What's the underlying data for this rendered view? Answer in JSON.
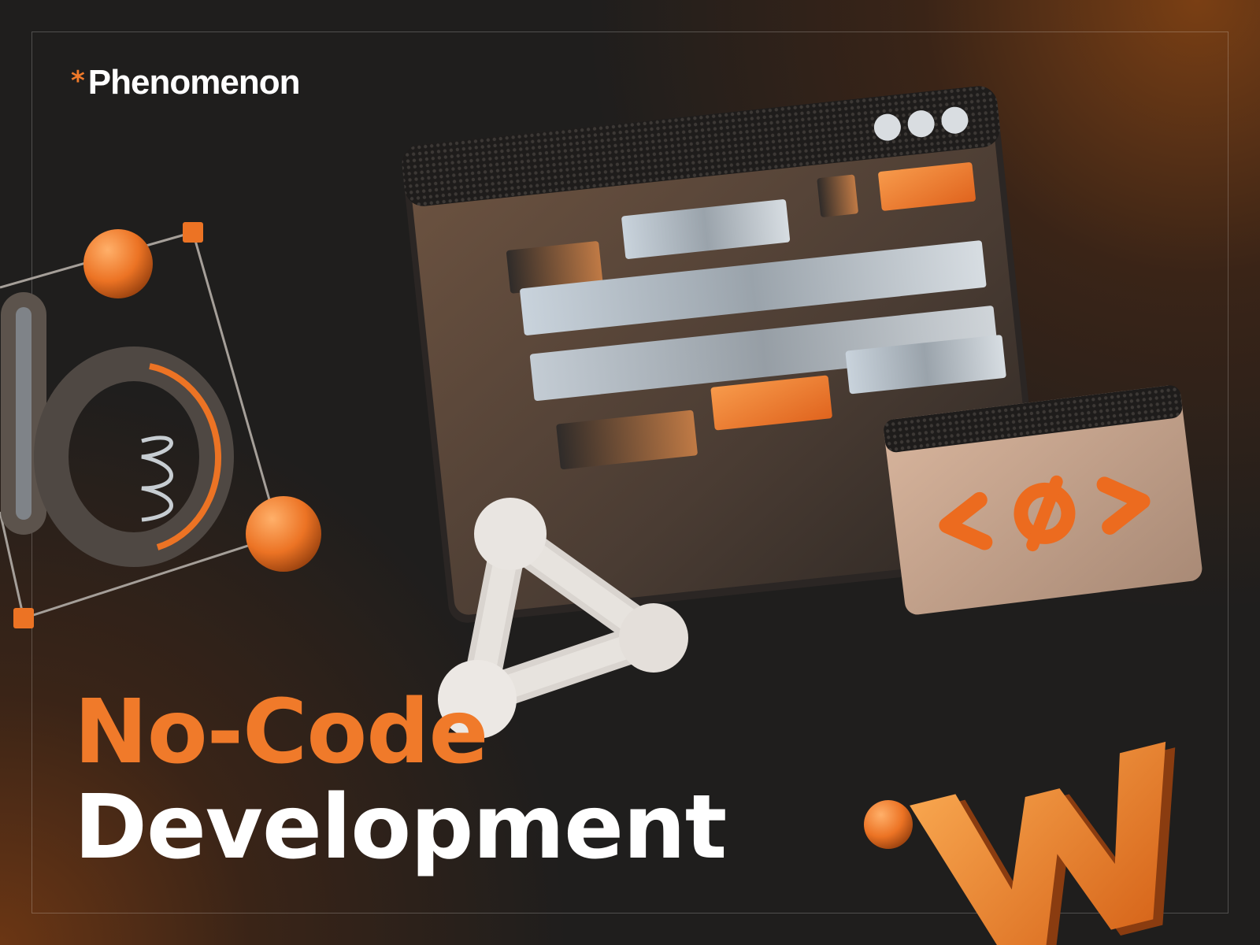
{
  "brand": {
    "symbol": "*",
    "name": "Phenomenon"
  },
  "headline": {
    "line1": "No-Code",
    "line2": "Development"
  },
  "colors": {
    "accent": "#f07a2a",
    "background": "#1f1e1d",
    "text": "#ffffff"
  },
  "illustrations": [
    "bezier-letter-b-icon",
    "browser-window-icon",
    "code-window-icon",
    "node-triangle-icon",
    "letter-w-icon",
    "orange-sphere-icon"
  ]
}
